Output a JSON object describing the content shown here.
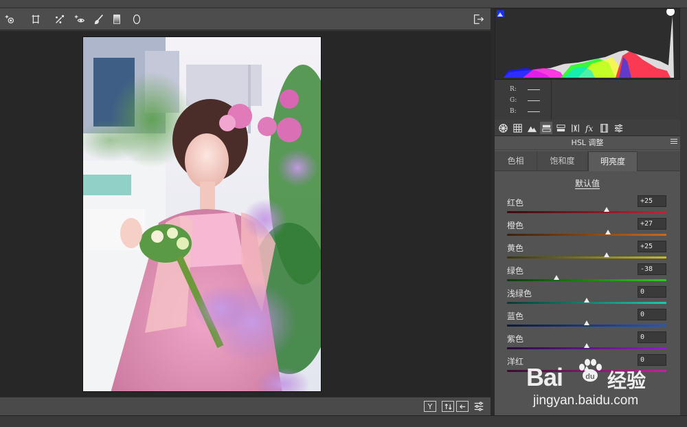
{
  "toolbar": {
    "tools": [
      "targeted-adjust-icon",
      "transform-icon",
      "spot-removal-icon",
      "red-eye-icon",
      "brush-icon",
      "graduated-filter-icon",
      "radial-filter-icon"
    ],
    "right_tool": "open-image-icon"
  },
  "histogram": {
    "shadow_clip_color": "#1530ff",
    "highlight_clip_color": "#ffffff",
    "r_label": "R:",
    "g_label": "G:",
    "b_label": "B:",
    "r_value": "",
    "g_value": "",
    "b_value": ""
  },
  "panel_tabs": [
    "basic-icon",
    "tone-curve-icon",
    "detail-icon",
    "hsl-icon",
    "split-toning-icon",
    "lens-icon",
    "fx-icon",
    "camera-calibration-icon",
    "presets-icon"
  ],
  "active_panel_tab": 3,
  "section": {
    "title": "HSL 调整"
  },
  "subtabs": [
    {
      "label": "色相"
    },
    {
      "label": "饱和度"
    },
    {
      "label": "明亮度"
    }
  ],
  "active_subtab": 2,
  "default_label": "默认值",
  "sliders": [
    {
      "label": "红色",
      "value": "+25",
      "level": 25,
      "colors": [
        "#3a0c10",
        "#c91f35"
      ]
    },
    {
      "label": "橙色",
      "value": "+27",
      "level": 27,
      "colors": [
        "#3a210c",
        "#c96a1f"
      ]
    },
    {
      "label": "黄色",
      "value": "+25",
      "level": 25,
      "colors": [
        "#3a360c",
        "#c9bd1f"
      ]
    },
    {
      "label": "绿色",
      "value": "-38",
      "level": -38,
      "colors": [
        "#0f3a0c",
        "#2fc91f"
      ]
    },
    {
      "label": "浅绿色",
      "value": "0",
      "level": 0,
      "colors": [
        "#0c3a33",
        "#1fc9ad"
      ]
    },
    {
      "label": "蓝色",
      "value": "0",
      "level": 0,
      "colors": [
        "#0c1a3a",
        "#1f58c9"
      ]
    },
    {
      "label": "紫色",
      "value": "0",
      "level": 0,
      "colors": [
        "#280c3a",
        "#901fc9"
      ]
    },
    {
      "label": "洋红",
      "value": "0",
      "level": 0,
      "colors": [
        "#3a0c2e",
        "#c91fa0"
      ]
    }
  ],
  "bottom_buttons": [
    "Y",
    "swap-icon",
    "before-after-icon",
    "settings-icon"
  ],
  "watermark": {
    "brand": "Bai",
    "brand_suffix": "经验",
    "url": "jingyan.baidu.com"
  }
}
